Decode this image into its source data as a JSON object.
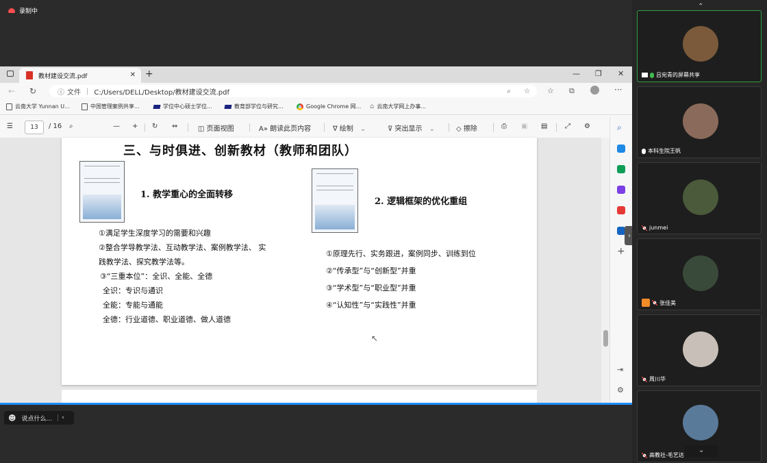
{
  "recording": {
    "label": "录制中"
  },
  "browser": {
    "tab_title": "教材建设交流.pdf",
    "address": {
      "info_label": "文件",
      "path": "C:/Users/DELL/Desktop/教材建设交流.pdf"
    },
    "bookmarks": [
      {
        "label": "云南大学 Yunnan U..."
      },
      {
        "label": "中国管理案例共享..."
      },
      {
        "label": "学位中心硕士学位..."
      },
      {
        "label": "教育部学位与研究..."
      },
      {
        "label": "Google Chrome 网..."
      },
      {
        "label": "云南大学网上办事..."
      }
    ]
  },
  "pdf_toolbar": {
    "page_current": "13",
    "page_total": "/ 16",
    "page_view": "页面视图",
    "read_aloud": "朗读此页内容",
    "draw": "绘制",
    "highlight": "突出显示",
    "erase": "擦除"
  },
  "slide": {
    "title": "三、与时俱进、创新教材（教师和团队）",
    "left_heading": "1. 教学重心的全面转移",
    "left_lines": [
      "①满足学生深度学习的需要和兴趣",
      "②整合学导教学法、互动教学法、案例教学法、 实",
      "践教学法、探究教学法等。",
      "③“三重本位”：全识、全能、全德",
      "全识：专识与通识",
      "全能：专能与通能",
      "全德：行业道德、职业道德、做人道德"
    ],
    "right_heading": "2. 逻辑框架的优化重组",
    "right_lines": [
      "①原理先行、实务跟进，案例同步、训练到位",
      "②“传承型”与“创新型”并重",
      "③“学术型”与“职业型”并重",
      "④“认知性”与“实践性”并重"
    ]
  },
  "chat": {
    "placeholder": "说点什么..."
  },
  "participants": [
    {
      "name": "吕宛青的屏幕共享",
      "active": true,
      "avatar_color": "#7a5a3a"
    },
    {
      "name": "本科生院王帆",
      "active": false,
      "avatar_color": "#8a6a5a"
    },
    {
      "name": "junmei",
      "active": false,
      "avatar_color": "#4a5a3a"
    },
    {
      "name": "张佳美",
      "active": false,
      "avatar_color": "#3a4a3a"
    },
    {
      "name": "周川华",
      "active": false,
      "avatar_color": "#c8c0b8"
    },
    {
      "name": "高教社-毛艺达",
      "active": false,
      "avatar_color": "#5a7a9a"
    }
  ]
}
